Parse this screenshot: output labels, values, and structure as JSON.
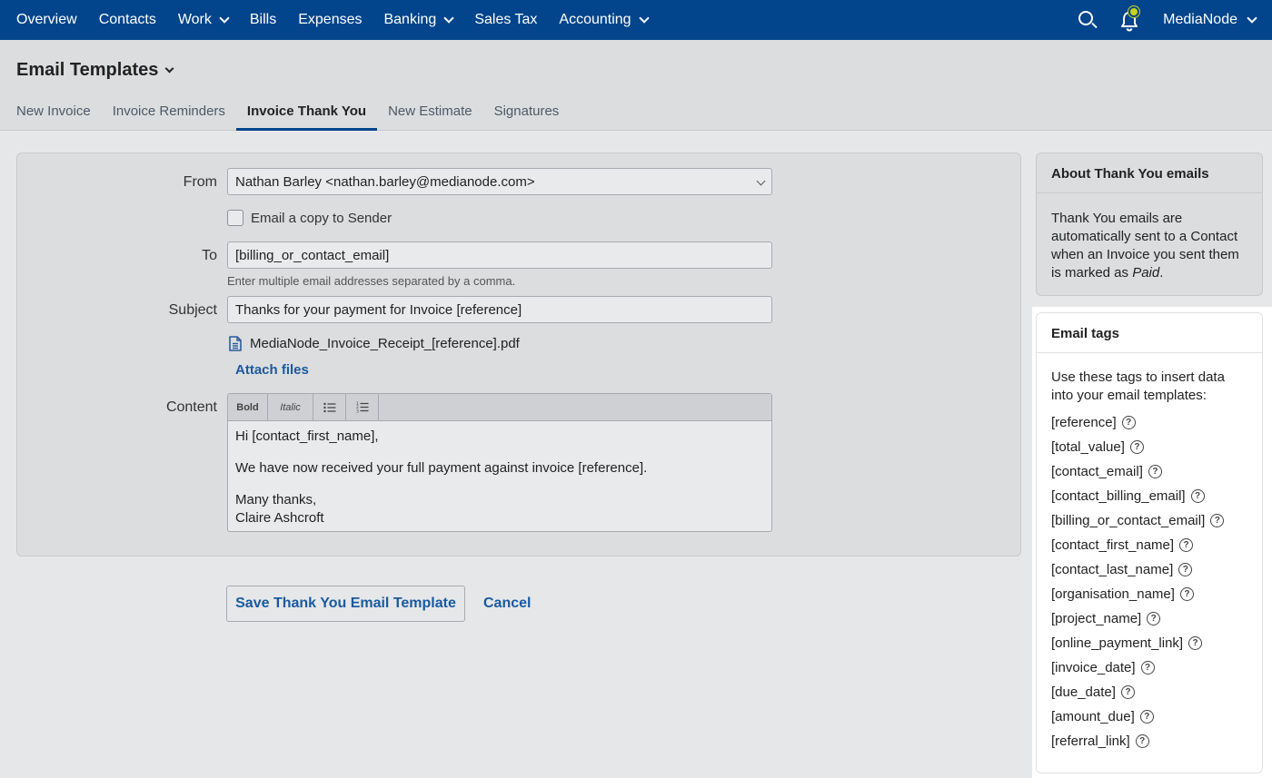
{
  "nav": {
    "items": [
      {
        "label": "Overview",
        "dropdown": false
      },
      {
        "label": "Contacts",
        "dropdown": false
      },
      {
        "label": "Work",
        "dropdown": true
      },
      {
        "label": "Bills",
        "dropdown": false
      },
      {
        "label": "Expenses",
        "dropdown": false
      },
      {
        "label": "Banking",
        "dropdown": true
      },
      {
        "label": "Sales Tax",
        "dropdown": false
      },
      {
        "label": "Accounting",
        "dropdown": true
      }
    ],
    "org_name": "MediaNode",
    "icons": [
      "search-icon",
      "bell-icon",
      "chevron-down-icon"
    ],
    "colors": {
      "bar": "#03458c",
      "notification_dot": "#c8d41c"
    }
  },
  "header": {
    "title": "Email Templates",
    "tabs": [
      {
        "label": "New Invoice",
        "active": false
      },
      {
        "label": "Invoice Reminders",
        "active": false
      },
      {
        "label": "Invoice Thank You",
        "active": true
      },
      {
        "label": "New Estimate",
        "active": false
      },
      {
        "label": "Signatures",
        "active": false
      }
    ]
  },
  "form": {
    "from_label": "From",
    "from_value": "Nathan Barley <nathan.barley@medianode.com>",
    "copy_label": "Email a copy to Sender",
    "copy_checked": false,
    "to_label": "To",
    "to_value": "[billing_or_contact_email]",
    "to_hint": "Enter multiple email addresses separated by a comma.",
    "subject_label": "Subject",
    "subject_value": "Thanks for your payment for Invoice [reference]",
    "attachment_name": "MediaNode_Invoice_Receipt_[reference].pdf",
    "attach_label": "Attach files",
    "content_label": "Content",
    "toolbar": {
      "bold": "Bold",
      "italic": "Italic"
    },
    "content": {
      "line1": "Hi [contact_first_name],",
      "line2": "We have now received your full payment against invoice [reference].",
      "line3": "Many thanks,",
      "line4": "Claire Ashcroft"
    }
  },
  "actions": {
    "save_label": "Save Thank You Email Template",
    "cancel_label": "Cancel"
  },
  "about": {
    "title": "About Thank You emails",
    "body_prefix": "Thank You emails are automatically sent to a Contact when an Invoice you sent them is marked as ",
    "body_em": "Paid",
    "body_suffix": "."
  },
  "tags": {
    "title": "Email tags",
    "intro": "Use these tags to insert data into your email templates:",
    "help_glyph": "?",
    "items": [
      "[reference]",
      "[total_value]",
      "[contact_email]",
      "[contact_billing_email]",
      "[billing_or_contact_email]",
      "[contact_first_name]",
      "[contact_last_name]",
      "[organisation_name]",
      "[project_name]",
      "[online_payment_link]",
      "[invoice_date]",
      "[due_date]",
      "[amount_due]",
      "[referral_link]"
    ]
  }
}
